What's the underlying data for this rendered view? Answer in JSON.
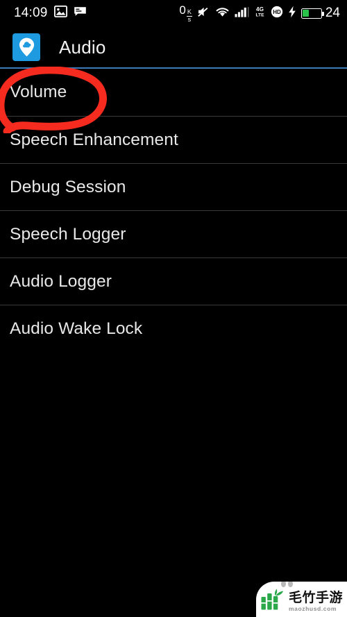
{
  "status_bar": {
    "time": "14:09",
    "left_icons": [
      "photo-icon",
      "message-icon"
    ],
    "net_speed_value": "0",
    "net_speed_unit_top": "K",
    "net_speed_unit_bottom": "s",
    "right_icons": [
      "mute-icon",
      "wifi-icon",
      "signal-bars-icon",
      "4g-lte-icon",
      "hd-icon",
      "charging-bolt-icon"
    ],
    "lte_label_top": "4G",
    "lte_label_bottom": "LTE",
    "hd_label": "HD",
    "battery_percent": "24",
    "battery_fill_ratio": 0.34,
    "battery_color": "#29c24a"
  },
  "app_bar": {
    "title": "Audio",
    "icon_name": "cloud-pin-app-icon",
    "icon_bg_color": "#1e9ae0",
    "underline_color": "#3b79b8"
  },
  "list": {
    "items": [
      {
        "label": "Volume"
      },
      {
        "label": "Speech Enhancement"
      },
      {
        "label": "Debug Session"
      },
      {
        "label": "Speech Logger"
      },
      {
        "label": "Audio Logger"
      },
      {
        "label": "Audio Wake Lock"
      }
    ]
  },
  "annotation": {
    "type": "hand-drawn-circle",
    "color": "#f42b1e",
    "targets_item": "Volume"
  },
  "watermark": {
    "brand_cn": "毛竹手游",
    "url": "maozhusd.com",
    "logo_name": "bamboo-logo",
    "logo_color": "#2aa84a",
    "panel_color": "#ffffff"
  }
}
